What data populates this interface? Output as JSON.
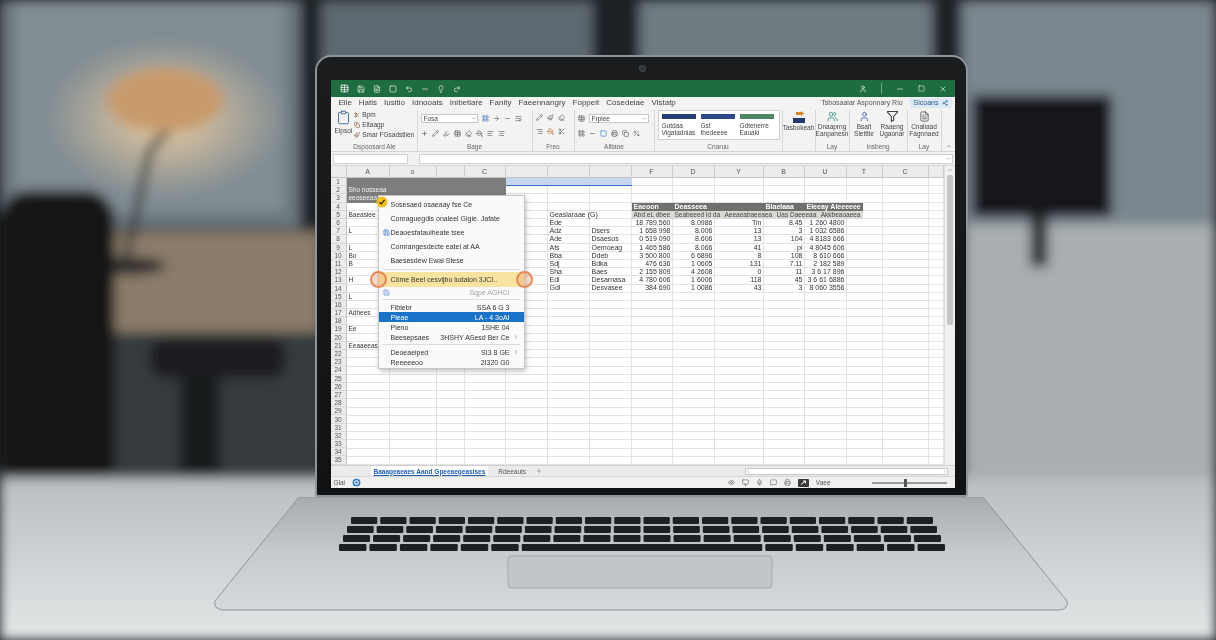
{
  "ribbon_tabs": [
    "Eile",
    "Hatis",
    "Iusitio",
    "Idnooats",
    "Inibetiare",
    "Fanity",
    "Faeennangry",
    "Foppeit",
    "Cosedeiae",
    "Vistatp"
  ],
  "account": "Tsbosaaiar Asponnary Rio",
  "share_button": "Sicoans",
  "ribbon_groups": [
    {
      "kind": "clipboard",
      "label": "Dspoosard Ale",
      "paste": "Eipsoi",
      "commands": [
        "Bpm",
        "Eltaagp",
        "Smar FGsadstlien"
      ]
    },
    {
      "kind": "font",
      "label": "Bage",
      "font_name": "Fosa"
    },
    {
      "kind": "alignment",
      "label": "Freo"
    },
    {
      "kind": "number",
      "label": "Alitane",
      "format": "Frpiee"
    },
    {
      "kind": "styles",
      "label": "Cnaruu",
      "styles": [
        {
          "label": "Gutdaa Vigatadnias",
          "color": "#24407a"
        },
        {
          "label": "Gst thedeeee",
          "color": "#2b4a86"
        },
        {
          "label": "Gdtenerre Eauaki",
          "color": "#4d8763"
        }
      ]
    },
    {
      "kind": "button",
      "button": "Tasbokeah"
    },
    {
      "kind": "commands",
      "label": "Lay",
      "buttons": [
        "Dnaaprng Eanpanesn"
      ]
    },
    {
      "kind": "commands",
      "label": "Insbeng",
      "buttons": [
        "Bsalt Sletttie",
        "Raaeng Ugaonar"
      ]
    },
    {
      "kind": "commands",
      "label": "Lay",
      "buttons": [
        "Cnaliaad Fagnnaed"
      ]
    }
  ],
  "sheet": {
    "column_headers": [
      {
        "label": "A",
        "selected": false
      },
      {
        "label": "o",
        "selected": false
      },
      {
        "selected": false
      },
      {
        "label": "C",
        "selected": false
      },
      {
        "selected": true
      },
      {
        "selected": true
      },
      {
        "selected": true
      },
      {
        "label": "F",
        "selected": false
      },
      {
        "label": "D",
        "selected": false
      },
      {
        "label": "Y",
        "selected": false
      },
      {
        "label": "B",
        "selected": false
      },
      {
        "label": "U",
        "selected": false
      },
      {
        "label": "T",
        "selected": false
      },
      {
        "label": "C",
        "selected": false
      },
      {
        "selected": false
      }
    ],
    "row_numbers": [
      "1",
      "2",
      "3",
      "4",
      "5",
      "6",
      "7",
      "8",
      "9",
      "10",
      "11",
      "12",
      "13",
      "14",
      "15",
      "16",
      "17",
      "18",
      "19",
      "20",
      "21",
      "22",
      "23",
      "24",
      "25",
      "26",
      "27",
      "28",
      "29",
      "30",
      "31",
      "32",
      "33",
      "34",
      "35"
    ],
    "title_band": [
      "Sho nosseaa",
      "eeoseeaa"
    ],
    "side_labels": [
      "Baeasiee",
      "L",
      "L",
      "Bo",
      "B",
      "H",
      "L",
      "Adhees",
      "Ee",
      "Eeaaeeas"
    ],
    "data_table": {
      "caption": "Geaslaraae (G)",
      "titles": [
        "Eaeoon",
        "Deasseea",
        "Blaelaaa",
        "Eleeay Aleeeeee"
      ],
      "subtitles": [
        "Abd eL dbee",
        "Seabeeed ld da",
        "Aeeaeabaeeaea",
        "Uas Daeeeaa",
        "Akkbeaoaeea"
      ],
      "rows": [
        {
          "col_1": "Ede",
          "col_3": "18 789.560",
          "col_4": "8.0986",
          "col_5": "Tin",
          "col_6": "8.45",
          "col_7": "1 260 4800"
        },
        {
          "col_1": "Adz",
          "col_2": "Dsers",
          "col_3": "1 658 998",
          "col_4": "8.006",
          "col_5": "13",
          "col_6": "3",
          "col_7": "1 032 6586"
        },
        {
          "col_1": "Ade",
          "col_2": "Dsaesos",
          "col_3": "0 519 090",
          "col_4": "8.606",
          "col_5": "13",
          "col_6": "104",
          "col_7": "4 8183 666"
        },
        {
          "col_1": "Afs",
          "col_2": "Oemoeag",
          "col_3": "1 465 586",
          "col_4": "8.066",
          "col_5": "41",
          "col_6": "pi",
          "col_7": "4 8045 606"
        },
        {
          "col_1": "Bba",
          "col_2": "Ddeb",
          "col_3": "3 500 800",
          "col_4": "6 6896",
          "col_5": "8",
          "col_6": "108",
          "col_7": "8 610 666"
        },
        {
          "col_1": "Sdj",
          "col_2": "Bdka",
          "col_3": "476 636",
          "col_4": "1 0605",
          "col_5": "131",
          "col_6": "7.11",
          "col_7": "2 182 589"
        },
        {
          "col_1": "Sha",
          "col_2": "Baes",
          "col_3": "2 155 809",
          "col_4": "4 2608",
          "col_5": "0",
          "col_6": "11",
          "col_7": "3 6 17 896"
        },
        {
          "col_1": "Edi",
          "col_2": "Desarnasa",
          "col_3": "4 780 606",
          "col_4": "1 6006",
          "col_5": "118",
          "col_6": "45",
          "col_7": "3 6 61 6886"
        },
        {
          "col_1": "Gdi",
          "col_2": "Desvasee",
          "col_3": "384 690",
          "col_4": "1 0086",
          "col_5": "43",
          "col_6": "3",
          "col_7": "8 060 3556"
        }
      ]
    }
  },
  "context_menu": {
    "items": [
      {
        "kind": "item",
        "label": "Sosesaed osaeaay fse Ce",
        "badge": true,
        "selected": false,
        "disabled": false,
        "submenu": false
      },
      {
        "kind": "item",
        "label": "Conraguegdis onaleel Gigie. Jafate",
        "badge": false,
        "selected": false,
        "disabled": false,
        "submenu": false
      },
      {
        "kind": "icon_item",
        "label": "Deaoesfatauiheate tsee",
        "badge": false,
        "selected": false,
        "disabled": false,
        "submenu": false
      },
      {
        "kind": "item",
        "label": "Comrangesdecte eatel at AA",
        "badge": false,
        "selected": false,
        "disabled": false,
        "submenu": false
      },
      {
        "kind": "item",
        "label": "Baesesdew Ewal Stese",
        "badge": false,
        "selected": false,
        "disabled": false,
        "submenu": false
      },
      {
        "kind": "separator"
      },
      {
        "kind": "spotlight",
        "label": "Cöme Beel cesvijbo ludalon 3JCI..",
        "badge": false,
        "selected": false,
        "disabled": false,
        "submenu": false
      },
      {
        "kind": "icon_item",
        "shortcut": "Sqpe AGHCI",
        "badge": false,
        "selected": false,
        "disabled": true,
        "submenu": false
      },
      {
        "kind": "separator"
      },
      {
        "kind": "item",
        "label": "Fiblebr",
        "shortcut": "SSA 6 G 3",
        "badge": false,
        "selected": false,
        "disabled": false,
        "submenu": false
      },
      {
        "kind": "item",
        "label": "Pieae",
        "shortcut": "LA - 4 3oAI",
        "badge": false,
        "selected": true,
        "disabled": false,
        "submenu": false
      },
      {
        "kind": "item",
        "label": "Pieno",
        "shortcut": "1SHE 04",
        "badge": false,
        "selected": false,
        "disabled": false,
        "submenu": false
      },
      {
        "kind": "item",
        "label": "Beesepsaes",
        "shortcut": "3HSHY ASesd Ber Ce",
        "badge": false,
        "selected": false,
        "disabled": false,
        "submenu": true
      },
      {
        "kind": "separator"
      },
      {
        "kind": "item",
        "label": "Deoeaeiped",
        "shortcut": "SI3 8 GE",
        "badge": false,
        "selected": false,
        "disabled": false,
        "submenu": true
      },
      {
        "kind": "item",
        "label": "Reeeeeoo",
        "shortcut": "2I320 G0",
        "badge": false,
        "selected": false,
        "disabled": false,
        "submenu": false
      }
    ]
  },
  "sheet_tabs": [
    {
      "label": "Baaageaeaes Aand Gpeeaegeasises",
      "selected": true
    },
    {
      "label": "Rdeeauts",
      "selected": false
    }
  ],
  "status_bar": {
    "mode": "Glai",
    "view": "Vaee",
    "zoom": {
      "level": 0.45
    }
  }
}
